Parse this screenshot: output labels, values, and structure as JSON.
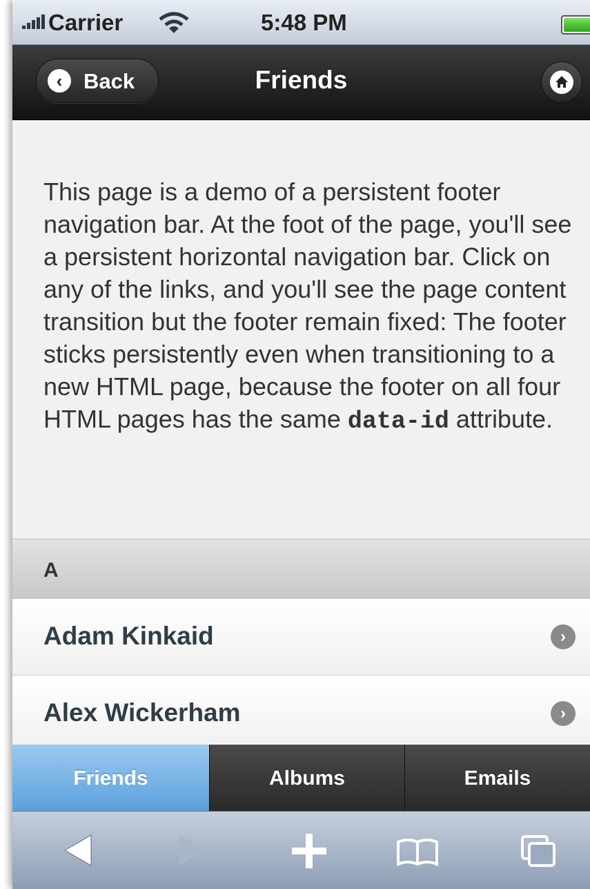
{
  "status_bar": {
    "carrier": "Carrier",
    "time": "5:48 PM",
    "icons": [
      "signal-icon",
      "wifi-icon",
      "battery-icon"
    ]
  },
  "header": {
    "back_label": "Back",
    "title": "Friends",
    "back_icon": "chevron-left-icon",
    "home_icon": "home-icon"
  },
  "intro": {
    "text_before": "This page is a demo of a persistent footer navigation bar. At the foot of the page, you'll see a persistent horizontal navigation bar. Click on any of the links, and you'll see the page content transition but the footer remain fixed: The footer sticks persistently even when transitioning to a new HTML page, because the footer on all four HTML pages has the same ",
    "code": "data-id",
    "text_after": " attribute."
  },
  "list": {
    "divider": "A",
    "items": [
      {
        "name": "Adam Kinkaid"
      },
      {
        "name": "Alex Wickerham"
      }
    ]
  },
  "footer_nav": {
    "tabs": [
      {
        "label": "Friends",
        "active": true
      },
      {
        "label": "Albums",
        "active": false
      },
      {
        "label": "Emails",
        "active": false
      }
    ],
    "active_color": "#6aaae0"
  },
  "browser_toolbar": {
    "buttons": [
      "back-arrow-icon",
      "forward-arrow-icon",
      "add-icon",
      "bookmarks-icon",
      "pages-icon"
    ]
  }
}
